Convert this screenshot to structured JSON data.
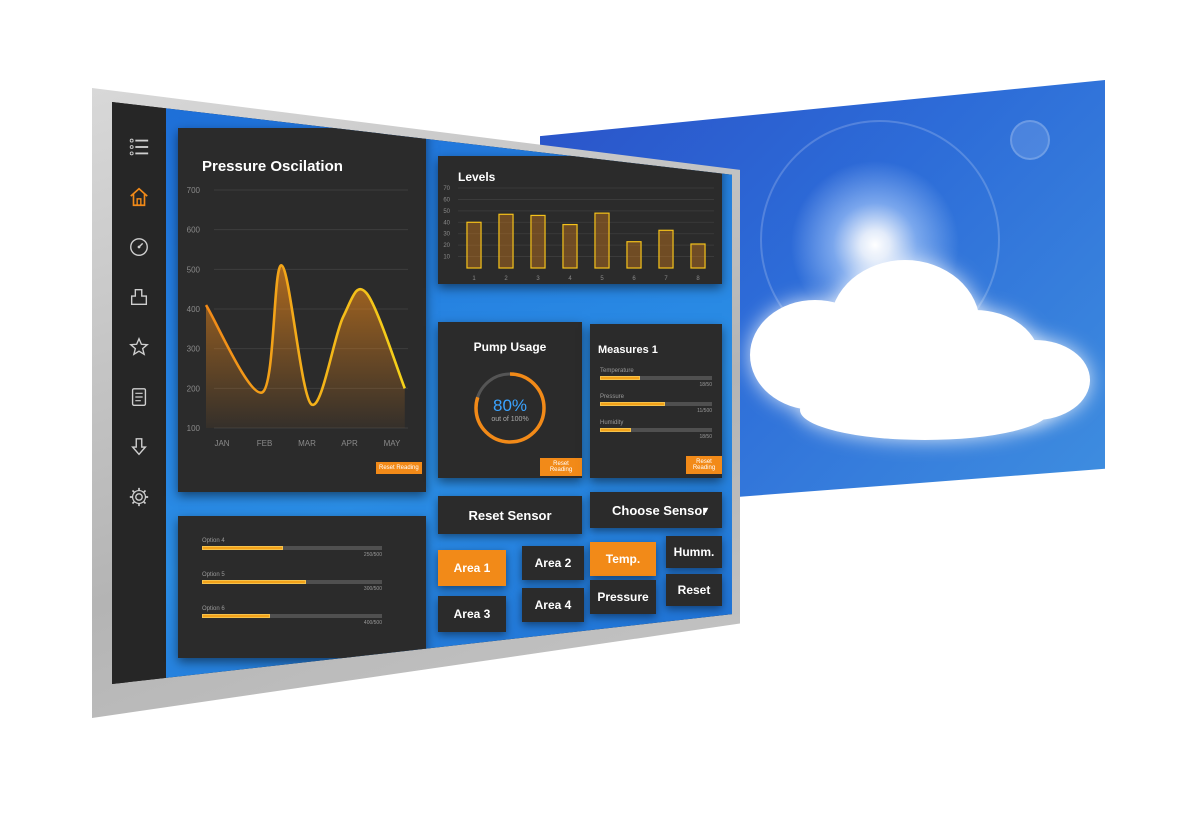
{
  "sidebar": {
    "items": [
      {
        "icon": "menu-icon"
      },
      {
        "icon": "home-icon"
      },
      {
        "icon": "gauge-icon"
      },
      {
        "icon": "tag-icon"
      },
      {
        "icon": "star-icon"
      },
      {
        "icon": "document-icon"
      },
      {
        "icon": "download-icon"
      },
      {
        "icon": "gear-icon"
      }
    ]
  },
  "pressure": {
    "title": "Pressure Oscilation",
    "button": "Reset Reading",
    "chart_data": {
      "type": "line",
      "title": "Pressure Oscilation",
      "categories": [
        "JAN",
        "FEB",
        "MAR",
        "APR",
        "MAY"
      ],
      "y_ticks": [
        "700",
        "600",
        "500",
        "400",
        "300",
        "200",
        "100"
      ],
      "ylim": [
        100,
        700
      ],
      "series": [
        {
          "values": [
            410,
            190,
            510,
            160,
            380,
            440,
            200
          ]
        }
      ],
      "x_positions": [
        0,
        0.95,
        1.4,
        2.1,
        2.85,
        3.4,
        4.3
      ],
      "line_color": "#f5a623",
      "grid": true
    }
  },
  "levels": {
    "title": "Levels",
    "chart_data": {
      "type": "bar",
      "title": "Levels",
      "categories": [
        "1",
        "2",
        "3",
        "4",
        "5",
        "6",
        "7",
        "8"
      ],
      "y_ticks": [
        "70",
        "60",
        "50",
        "40",
        "30",
        "20",
        "10"
      ],
      "ylim": [
        0,
        70
      ],
      "values": [
        40,
        47,
        46,
        38,
        48,
        23,
        33,
        21
      ],
      "bar_color": "#f28a18"
    }
  },
  "pump": {
    "title": "Pump Usage",
    "value": "80%",
    "subtitle": "out of 100%",
    "percent": 0.8,
    "button": "Reset Reading"
  },
  "measures": {
    "title": "Measures 1",
    "button": "Reset Reading",
    "rows": [
      {
        "label": "Temperature",
        "value": "18/50",
        "fraction": 0.36
      },
      {
        "label": "Pressure",
        "value": "11/500",
        "fraction": 0.58
      },
      {
        "label": "Humidity",
        "value": "18/50",
        "fraction": 0.28
      }
    ]
  },
  "options": {
    "rows": [
      {
        "label": "Option 4",
        "value": "250/500",
        "fraction": 0.45
      },
      {
        "label": "Option 5",
        "value": "300/500",
        "fraction": 0.58
      },
      {
        "label": "Option 6",
        "value": "400/500",
        "fraction": 0.38
      }
    ]
  },
  "controls": {
    "reset_sensor": "Reset Sensor",
    "choose_sensor": "Choose Sensor",
    "buttons": [
      {
        "label": "Area 1",
        "active": true
      },
      {
        "label": "Area 2",
        "active": false
      },
      {
        "label": "Temp.",
        "active": true
      },
      {
        "label": "Humm.",
        "active": false
      },
      {
        "label": "Area 3",
        "active": false
      },
      {
        "label": "Area 4",
        "active": false
      },
      {
        "label": "Pressure",
        "active": false
      },
      {
        "label": "Reset",
        "active": false
      }
    ]
  },
  "colors": {
    "accent": "#f28a18",
    "panel": "#2b2b2b",
    "background": "#2b8ee6"
  }
}
